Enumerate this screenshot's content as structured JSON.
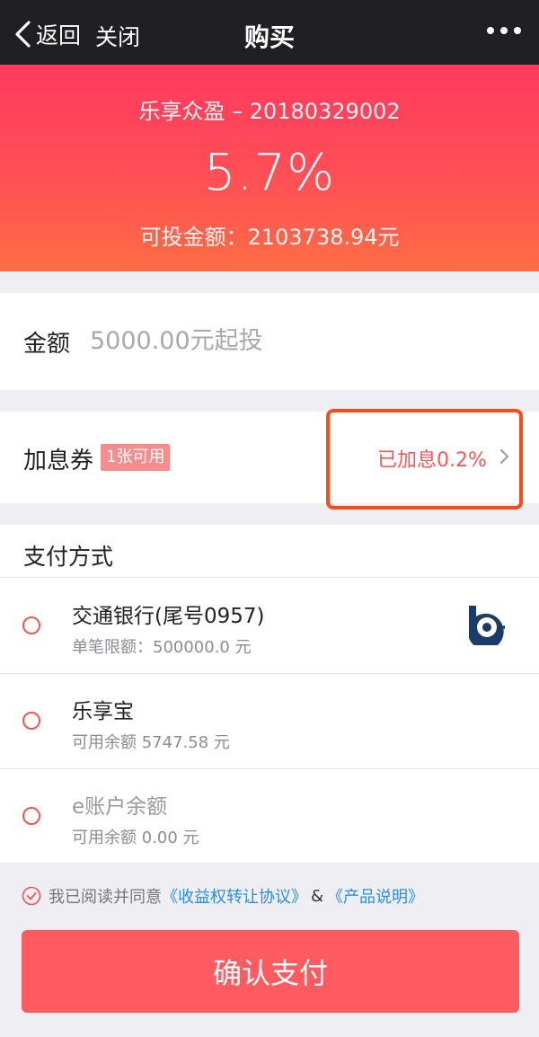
{
  "nav": {
    "back_label": "返回",
    "close_label": "关闭",
    "title": "购买"
  },
  "hero": {
    "product_name": "乐享众盈 – 20180329002",
    "rate": "5.7%",
    "available_amount": "可投金额：2103738.94元"
  },
  "amount": {
    "label": "金额",
    "placeholder": "5000.00元起投",
    "value": ""
  },
  "coupon": {
    "label": "加息券",
    "badge": "1张可用",
    "value": "已加息0.2%"
  },
  "payment": {
    "title": "支付方式",
    "methods": [
      {
        "name": "交通银行(尾号0957)",
        "sub": "单笔限额：500000.0 元",
        "icon": "bocom-bank-logo",
        "selected": false,
        "enabled": true
      },
      {
        "name": "乐享宝",
        "sub": "可用余额 5747.58 元",
        "selected": false,
        "enabled": true
      },
      {
        "name": "e账户余额",
        "sub": "可用余额 0.00 元",
        "selected": false,
        "enabled": false
      }
    ]
  },
  "agreement": {
    "prefix": "我已阅读并同意",
    "link1": "《收益权转让协议》",
    "amp": "&",
    "link2": "《产品说明》",
    "checked": true
  },
  "confirm": {
    "label": "确认支付"
  },
  "colors": {
    "nav_bg": "#1f1f24",
    "hero_gradient_top": "#ff3a5e",
    "hero_gradient_bottom": "#ff6c44",
    "accent_red": "#ff5b60",
    "highlight_box": "#ff4a16",
    "link_blue": "#2a8fe0"
  }
}
